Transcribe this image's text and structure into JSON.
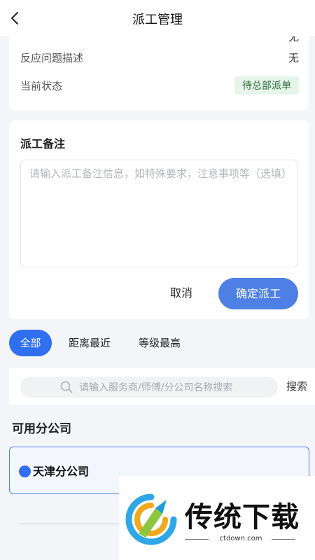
{
  "header": {
    "title": "派工管理",
    "back_icon": "chevron-left-icon"
  },
  "info": {
    "cut_row_value": "无",
    "issue_label": "反应问题描述",
    "issue_value": "无",
    "status_label": "当前状态",
    "status_value": "待总部派单",
    "status_color": "#e6f5ea"
  },
  "remark": {
    "title": "派工备注",
    "placeholder": "请输入派工备注信息，如特殊要求，注意事项等（选填）",
    "cancel_label": "取消",
    "confirm_label": "确定派工"
  },
  "filters": {
    "tabs": [
      "全部",
      "距离最近",
      "等级最高"
    ],
    "active": "全部"
  },
  "search": {
    "placeholder": "请输入服务商/师傅/分公司名称搜索",
    "button_label": "搜索",
    "icon": "search-icon"
  },
  "companies": {
    "section_title": "可用分公司",
    "items": [
      {
        "name": "天津分公司",
        "selected": true
      }
    ]
  },
  "watermark": {
    "text": "传统下载",
    "url": "ctdown.com"
  },
  "colors": {
    "accent": "#2f6ff0",
    "confirm": "#4e7fe5",
    "background": "#f3f5f8"
  }
}
